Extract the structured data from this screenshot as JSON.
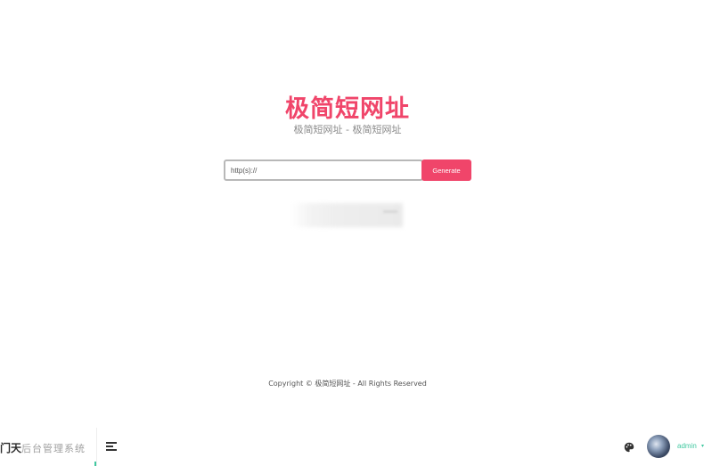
{
  "hero": {
    "title": "极简短网址",
    "subtitle": "极简短网址 - 极简短网址"
  },
  "form": {
    "url_placeholder": "http(s)://",
    "generate_label": "Generate"
  },
  "footer": {
    "copyright": "Copyright © 极简短网址 - All Rights Reserved"
  },
  "admin_bar": {
    "logo_text": "门天",
    "logo_sub": "后台管理系统",
    "user_name": "admin",
    "caret": "▾"
  },
  "colors": {
    "brand": "#f0456a",
    "accent": "#41c8a0"
  },
  "icons": {
    "menu": "hamburger-menu-icon",
    "theme": "palette-icon",
    "dropdown": "caret-down-icon"
  }
}
